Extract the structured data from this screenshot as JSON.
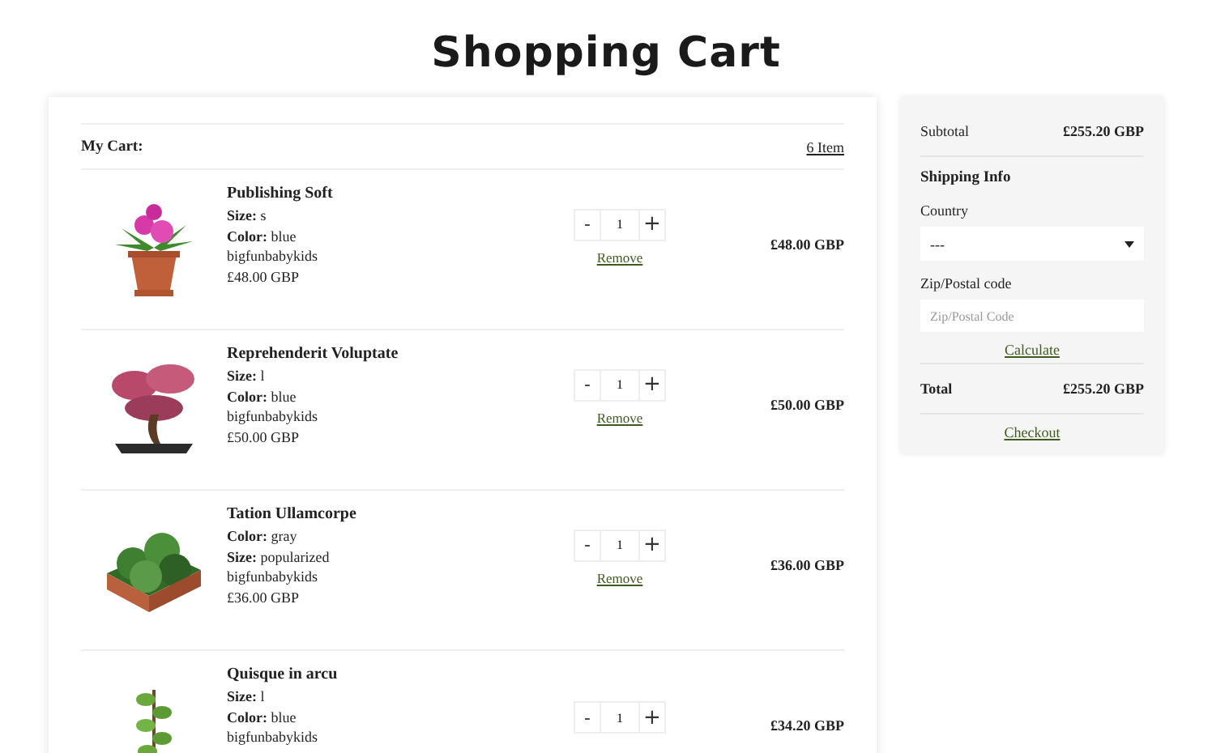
{
  "title": "Shopping Cart",
  "cart": {
    "heading": "My Cart:",
    "count": "6 Item",
    "items": [
      {
        "name": "Publishing Soft",
        "kind": "flower",
        "attributes": [
          {
            "label": "Size:",
            "value": "s"
          },
          {
            "label": "Color:",
            "value": "blue"
          }
        ],
        "vendor": "bigfunbabykids",
        "unit_price": "£48.00 GBP",
        "quantity": "1",
        "minus": "-",
        "plus": "+",
        "remove": "Remove",
        "total": "£48.00 GBP"
      },
      {
        "name": "Reprehenderit Voluptate",
        "kind": "bonsai",
        "attributes": [
          {
            "label": "Size:",
            "value": "l"
          },
          {
            "label": "Color:",
            "value": "blue"
          }
        ],
        "vendor": "bigfunbabykids",
        "unit_price": "£50.00 GBP",
        "quantity": "1",
        "minus": "-",
        "plus": "+",
        "remove": "Remove",
        "total": "£50.00 GBP"
      },
      {
        "name": "Tation Ullamcorpe",
        "kind": "tray",
        "attributes": [
          {
            "label": "Color:",
            "value": "gray"
          },
          {
            "label": "Size:",
            "value": "popularized"
          }
        ],
        "vendor": "bigfunbabykids",
        "unit_price": "£36.00 GBP",
        "quantity": "1",
        "minus": "-",
        "plus": "+",
        "remove": "Remove",
        "total": "£36.00 GBP"
      },
      {
        "name": "Quisque in arcu",
        "kind": "tall",
        "attributes": [
          {
            "label": "Size:",
            "value": "l"
          },
          {
            "label": "Color:",
            "value": "blue"
          }
        ],
        "vendor": "bigfunbabykids",
        "quantity": "1",
        "minus": "-",
        "plus": "+",
        "total": "£34.20 GBP"
      }
    ]
  },
  "summary": {
    "subtotal_label": "Subtotal",
    "subtotal": "£255.20 GBP",
    "shipping_heading": "Shipping Info",
    "country_label": "Country",
    "country_value": "---",
    "zip_label": "Zip/Postal code",
    "zip_placeholder": "Zip/Postal Code",
    "calculate": "Calculate",
    "total_label": "Total",
    "total": "£255.20 GBP",
    "checkout": "Checkout"
  }
}
